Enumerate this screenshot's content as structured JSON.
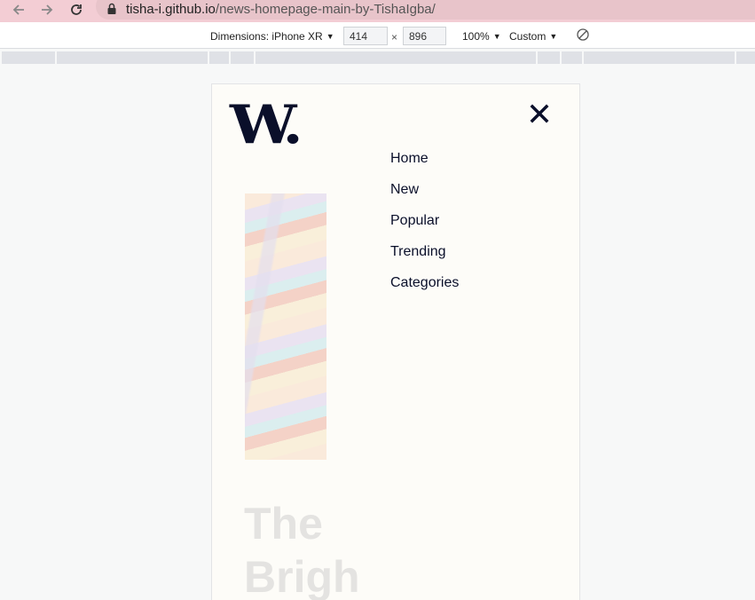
{
  "browser": {
    "url_host": "tisha-i.github.io",
    "url_path": "/news-homepage-main-by-TishaIgba/",
    "back_icon": "back-arrow-icon",
    "forward_icon": "forward-arrow-icon",
    "reload_icon": "reload-icon",
    "lock_icon": "lock-icon"
  },
  "devtools": {
    "dimensions_label": "Dimensions: iPhone XR",
    "width_value": "414",
    "height_value": "896",
    "times_sign": "×",
    "zoom_label": "100%",
    "throttle_label": "Custom",
    "rotate_icon": "rotate-icon"
  },
  "site": {
    "logo_text": "W.",
    "close_icon": "close-icon",
    "menu": [
      {
        "label": "Home"
      },
      {
        "label": "New"
      },
      {
        "label": "Popular"
      },
      {
        "label": "Trending"
      },
      {
        "label": "Categories"
      }
    ],
    "headline": "The\nBrigh"
  },
  "colors": {
    "address_bar": "#f3cdd4",
    "brand_dark": "#0a0f2a",
    "page_bg": "#fdfcf8"
  }
}
